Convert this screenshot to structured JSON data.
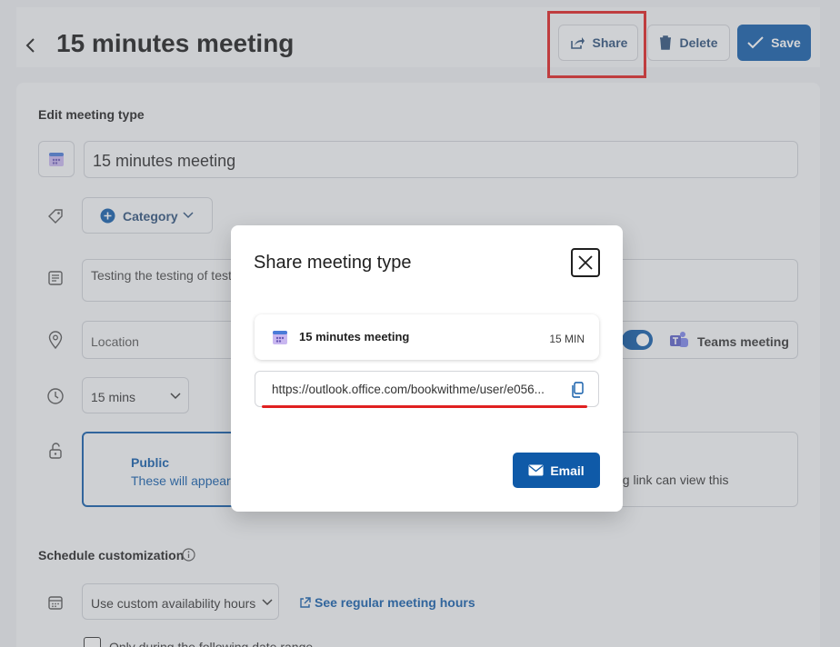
{
  "header": {
    "title": "15 minutes meeting",
    "share_label": "Share",
    "delete_label": "Delete",
    "save_label": "Save"
  },
  "form": {
    "section_edit": "Edit meeting type",
    "meeting_name": "15 minutes meeting",
    "category_label": "Category",
    "description": "Testing the testing of test",
    "location_placeholder": "Location",
    "teams_label": "Teams meeting",
    "duration_value": "15 mins",
    "visibility_public_title": "Public",
    "visibility_public_desc": "These will appear",
    "visibility_private_desc": "ng link can view this",
    "section_schedule": "Schedule customization",
    "availability_value": "Use custom availability hours",
    "see_hours_link": "See regular meeting hours",
    "date_range_label": "Only during the following date range"
  },
  "modal": {
    "title": "Share meeting type",
    "meeting_name": "15 minutes meeting",
    "duration": "15 MIN",
    "link": "https://outlook.office.com/bookwithme/user/e056...",
    "email_label": "Email"
  },
  "colors": {
    "primary": "#0f5aa8",
    "highlight": "#e02020",
    "teams": "#5b5fc7"
  }
}
